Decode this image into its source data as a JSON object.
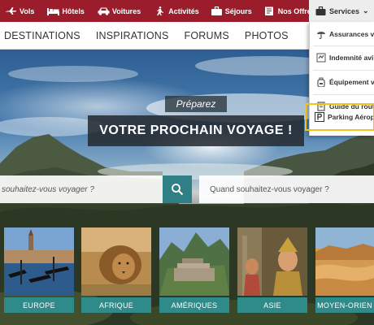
{
  "topbar": {
    "items": [
      {
        "label": "Vols",
        "icon": "plane-icon"
      },
      {
        "label": "Hôtels",
        "icon": "bed-icon"
      },
      {
        "label": "Voitures",
        "icon": "car-icon"
      },
      {
        "label": "Activités",
        "icon": "hiker-icon"
      },
      {
        "label": "Séjours",
        "icon": "suitcase-icon"
      },
      {
        "label": "Nos Offres",
        "icon": "offers-icon"
      }
    ],
    "services_label": "Services",
    "bg_color": "#9b1d2c"
  },
  "mainnav": {
    "items": [
      "DESTINATIONS",
      "INSPIRATIONS",
      "FORUMS",
      "PHOTOS"
    ]
  },
  "hero": {
    "kicker": "Préparez",
    "title": "VOTRE PROCHAIN VOYAGE !",
    "search_where_placeholder": "souhaitez-vous voyager ?",
    "search_when_placeholder": "Quand souhaitez-vous voyager ?",
    "accent_color": "#2f7f86"
  },
  "destinations": [
    {
      "label": "EUROPE"
    },
    {
      "label": "AFRIQUE"
    },
    {
      "label": "AMÉRIQUES"
    },
    {
      "label": "ASIE"
    },
    {
      "label": "MOYEN-ORIEN"
    }
  ],
  "services_dropdown": {
    "items": [
      {
        "label": "Assurances vo",
        "icon": "umbrella-icon"
      },
      {
        "label": "Indemnité avi",
        "icon": "scale-icon"
      },
      {
        "label": "Équipement v",
        "icon": "backpack-icon"
      },
      {
        "label": "Guide du rout",
        "icon": "book-icon"
      },
      {
        "label": "Parking Aérop",
        "icon": "parking-icon",
        "highlighted": true
      }
    ],
    "highlight_color": "#f3c51a"
  }
}
